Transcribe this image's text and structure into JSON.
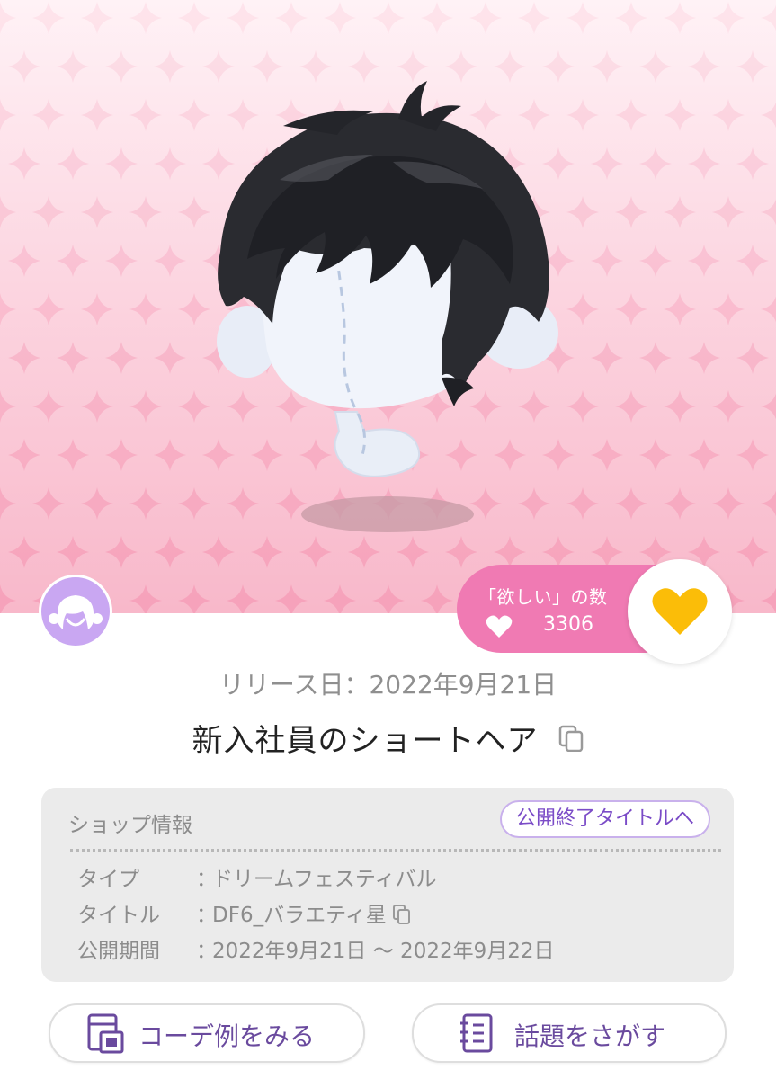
{
  "hero": {
    "background_colors": [
      "#fff2f6",
      "#f8b8ca"
    ],
    "item_image": "short-black-hair-on-mannequin-head"
  },
  "category": {
    "icon": "hair-category-icon",
    "color": "#c9a7f2"
  },
  "wishlist": {
    "label": "「欲しい」の数",
    "count": "3306",
    "pill_color": "#f07ab3",
    "heart_color": "#fbbd08"
  },
  "item": {
    "release": "リリース日：2022年9月21日",
    "title": "新入社員のショートヘア"
  },
  "shop_info": {
    "heading": "ショップ情報",
    "ended_titles_button": "公開終了タイトルへ",
    "rows": [
      {
        "key": "タイプ",
        "colon": "：",
        "value": "ドリームフェスティバル"
      },
      {
        "key": "タイトル",
        "colon": "：",
        "value": "DF6_バラエティ星"
      },
      {
        "key": "公開期間",
        "colon": "：",
        "value": "2022年9月21日 ～ 2022年9月22日"
      }
    ]
  },
  "actions": {
    "coordinate_label": "コーデ例をみる",
    "topic_label": "話題をさがす",
    "accent_color": "#6a4a9e"
  }
}
